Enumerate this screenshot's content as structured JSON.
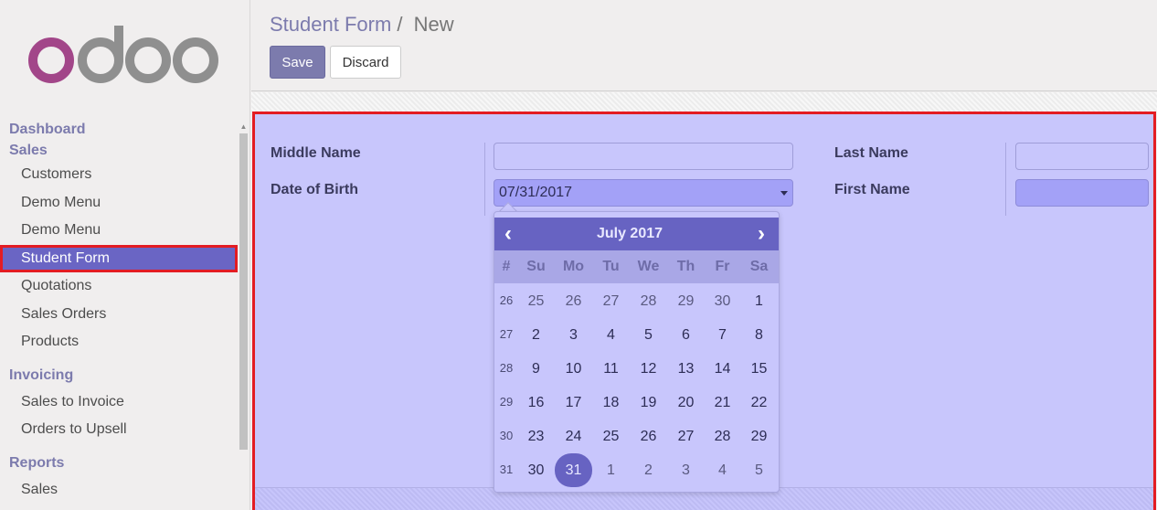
{
  "app": {
    "logo_text": "odoo"
  },
  "sidebar": {
    "sections": [
      {
        "header": "Dashboard",
        "items": []
      },
      {
        "header": "Sales",
        "items": [
          "Customers",
          "Demo Menu",
          "Demo Menu",
          "Student Form",
          "Quotations",
          "Sales Orders",
          "Products"
        ]
      },
      {
        "header": "Invoicing",
        "items": [
          "Sales to Invoice",
          "Orders to Upsell"
        ]
      },
      {
        "header": "Reports",
        "items": [
          "Sales"
        ]
      }
    ],
    "active_item": "Student Form"
  },
  "control_panel": {
    "breadcrumb_parent": "Student Form",
    "breadcrumb_sep": "/",
    "breadcrumb_current": "New",
    "save_label": "Save",
    "discard_label": "Discard"
  },
  "form": {
    "middle_name_label": "Middle Name",
    "middle_name_value": "",
    "dob_label": "Date of Birth",
    "dob_value": "07/31/2017",
    "last_name_label": "Last Name",
    "last_name_value": "",
    "first_name_label": "First Name",
    "first_name_value": ""
  },
  "datepicker": {
    "title": "July 2017",
    "prev": "‹",
    "next": "›",
    "dow": [
      "#",
      "Su",
      "Mo",
      "Tu",
      "We",
      "Th",
      "Fr",
      "Sa"
    ],
    "weeks": [
      {
        "wk": "26",
        "days": [
          [
            "25",
            "old"
          ],
          [
            "26",
            "old"
          ],
          [
            "27",
            "old"
          ],
          [
            "28",
            "old"
          ],
          [
            "29",
            "old"
          ],
          [
            "30",
            "old"
          ],
          [
            "1",
            ""
          ]
        ]
      },
      {
        "wk": "27",
        "days": [
          [
            "2",
            ""
          ],
          [
            "3",
            ""
          ],
          [
            "4",
            ""
          ],
          [
            "5",
            ""
          ],
          [
            "6",
            ""
          ],
          [
            "7",
            ""
          ],
          [
            "8",
            ""
          ]
        ]
      },
      {
        "wk": "28",
        "days": [
          [
            "9",
            ""
          ],
          [
            "10",
            ""
          ],
          [
            "11",
            ""
          ],
          [
            "12",
            ""
          ],
          [
            "13",
            ""
          ],
          [
            "14",
            ""
          ],
          [
            "15",
            ""
          ]
        ]
      },
      {
        "wk": "29",
        "days": [
          [
            "16",
            ""
          ],
          [
            "17",
            ""
          ],
          [
            "18",
            ""
          ],
          [
            "19",
            ""
          ],
          [
            "20",
            ""
          ],
          [
            "21",
            ""
          ],
          [
            "22",
            ""
          ]
        ]
      },
      {
        "wk": "30",
        "days": [
          [
            "23",
            ""
          ],
          [
            "24",
            ""
          ],
          [
            "25",
            ""
          ],
          [
            "26",
            ""
          ],
          [
            "27",
            ""
          ],
          [
            "28",
            ""
          ],
          [
            "29",
            ""
          ]
        ]
      },
      {
        "wk": "31",
        "days": [
          [
            "30",
            ""
          ],
          [
            "31",
            "sel"
          ],
          [
            "1",
            "old"
          ],
          [
            "2",
            "old"
          ],
          [
            "3",
            "old"
          ],
          [
            "4",
            "old"
          ],
          [
            "5",
            "old"
          ]
        ]
      }
    ]
  },
  "colors": {
    "brand": "#7c7bad",
    "active": "#6a65c4",
    "highlight_border": "#e31c23"
  }
}
